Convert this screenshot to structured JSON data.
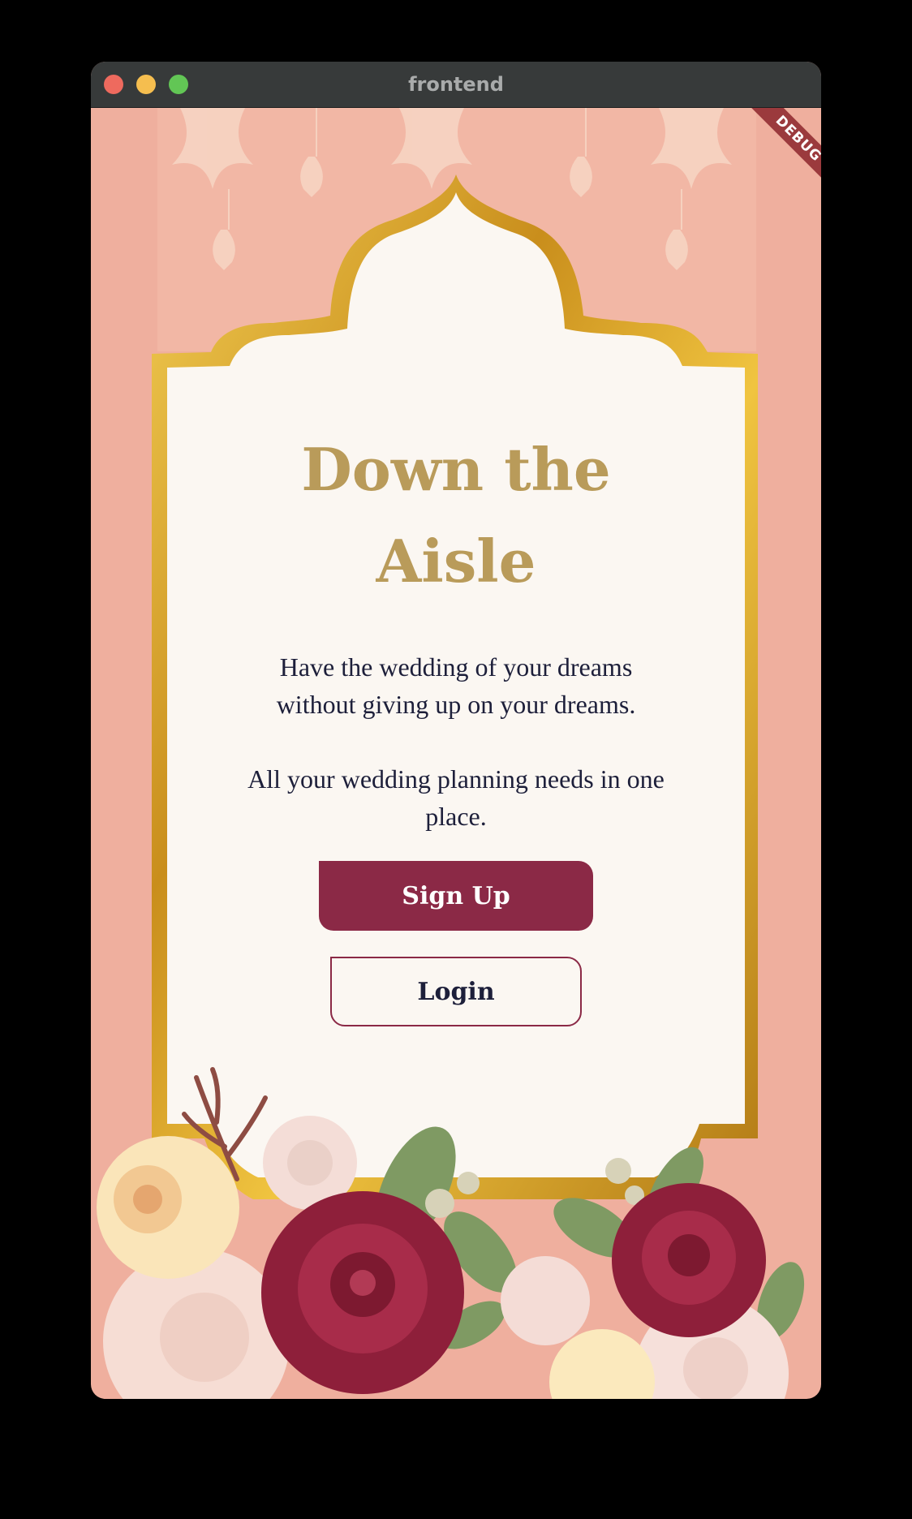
{
  "window": {
    "title": "frontend"
  },
  "debug_banner": "DEBUG",
  "hero": {
    "title_line1": "Down the",
    "title_line2": "Aisle",
    "tagline_line1": "Have the wedding of your dreams",
    "tagline_line2": "without giving up on your dreams.",
    "description_line1": "All your wedding planning needs in one",
    "description_line2": "place."
  },
  "actions": {
    "signup_label": "Sign Up",
    "login_label": "Login"
  },
  "colors": {
    "background": "#efaf9e",
    "panel": "#fbf7f2",
    "gold_frame": "#d9a52c",
    "heading": "#b99b5a",
    "body_text": "#1d1f3a",
    "primary_button": "#8b2946"
  },
  "icons": {
    "close": "close-window-icon",
    "minimize": "minimize-window-icon",
    "maximize": "maximize-window-icon"
  }
}
